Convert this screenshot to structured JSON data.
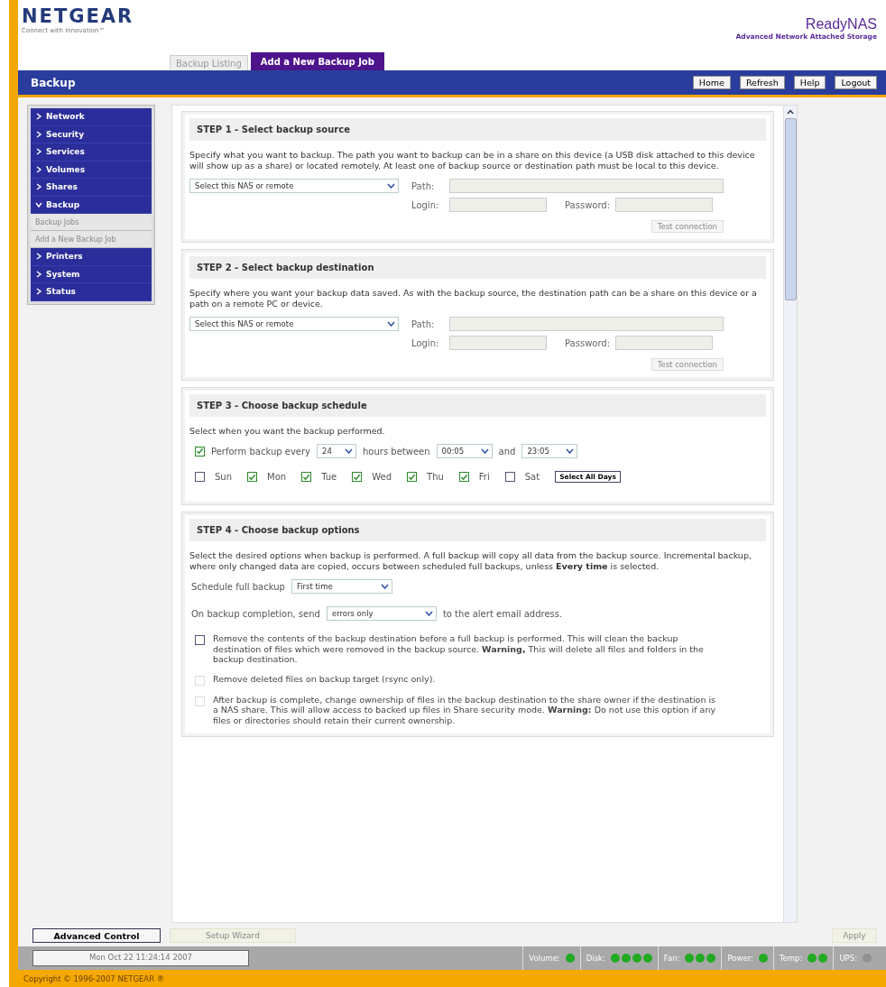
{
  "header": {
    "logo": "NETGEAR",
    "tagline": "Connect with Innovation™",
    "product": "ReadyNAS",
    "product_subtitle": "Advanced Network Attached Storage"
  },
  "tabs": [
    {
      "label": "Backup Listing",
      "selected": false
    },
    {
      "label": "Add a New Backup Job",
      "selected": true
    }
  ],
  "title_bar": {
    "title": "Backup",
    "buttons": [
      "Home",
      "Refresh",
      "Help",
      "Logout"
    ]
  },
  "sidebar": {
    "items": [
      {
        "label": "Network",
        "expanded": false
      },
      {
        "label": "Security",
        "expanded": false
      },
      {
        "label": "Services",
        "expanded": false
      },
      {
        "label": "Volumes",
        "expanded": false
      },
      {
        "label": "Shares",
        "expanded": false
      },
      {
        "label": "Backup",
        "expanded": true,
        "children": [
          {
            "label": "Backup Jobs"
          },
          {
            "label": "Add a New Backup Job"
          }
        ]
      },
      {
        "label": "Printers",
        "expanded": false
      },
      {
        "label": "System",
        "expanded": false
      },
      {
        "label": "Status",
        "expanded": false
      }
    ]
  },
  "step1": {
    "title": "STEP 1 - Select backup source",
    "description": "Specify what you want to backup. The path you want to backup can be in a share on this device (a USB disk attached to this device will show up as a share) or located remotely. At least one of backup source or destination path must be local to this device.",
    "select": "Select this NAS or remote",
    "path_label": "Path:",
    "login_label": "Login:",
    "password_label": "Password:",
    "test_button": "Test connection"
  },
  "step2": {
    "title": "STEP 2 - Select backup destination",
    "description": "Specify where you want your backup data saved. As with the backup source, the destination path can be a share on this device or a path on a remote PC or device.",
    "select": "Select this NAS or remote",
    "path_label": "Path:",
    "login_label": "Login:",
    "password_label": "Password:",
    "test_button": "Test connection"
  },
  "step3": {
    "title": "STEP 3 - Choose backup schedule",
    "description": "Select when you want the backup performed.",
    "perform": {
      "checked": true,
      "label": "Perform backup every",
      "hours": "24",
      "hours_label": "hours between",
      "start": "00:05",
      "and_label": "and",
      "end": "23:05"
    },
    "days": [
      {
        "label": "Sun",
        "checked": false
      },
      {
        "label": "Mon",
        "checked": true
      },
      {
        "label": "Tue",
        "checked": true
      },
      {
        "label": "Wed",
        "checked": true
      },
      {
        "label": "Thu",
        "checked": true
      },
      {
        "label": "Fri",
        "checked": true
      },
      {
        "label": "Sat",
        "checked": false
      }
    ],
    "select_all_button": "Select All Days"
  },
  "step4": {
    "title": "STEP 4 - Choose backup options",
    "description": "Select the desired options when backup is performed. A full backup will copy all data from the backup source. Incremental backup, where only changed data are copied, occurs between scheduled full backups, unless **Every time** is selected.",
    "full_backup_label": "Schedule full backup",
    "full_backup": "First time",
    "send_label": "On backup completion, send",
    "send": "errors only",
    "send_suffix": "to the alert email address.",
    "options": [
      {
        "text": "Remove the contents of the backup destination before a full backup is performed. This will clean the backup destination of files which were removed in the backup source. **Warning,** This will delete all files and folders in the backup destination.",
        "checked": false,
        "disabled": false
      },
      {
        "text": "Remove deleted files on backup target (rsync only).",
        "checked": false,
        "disabled": true
      },
      {
        "text": "After backup is complete, change ownership of files in the backup destination to the share owner if the destination is a NAS share. This will allow access to backed up files in Share security mode. **Warning:** Do not use this option if any files or directories should retain their current ownership.",
        "checked": false,
        "disabled": true
      }
    ]
  },
  "bottom_bar": {
    "advanced_button": "Advanced Control",
    "wizard_button": "Setup Wizard",
    "apply_button": "Apply"
  },
  "status_bar": {
    "datetime": "Mon Oct 22  11:24:14 2007",
    "indicators": [
      {
        "label": "Volume:",
        "lights": [
          {
            "color": "#22aa22"
          }
        ]
      },
      {
        "label": "Disk:",
        "lights": [
          {
            "color": "#22aa22"
          },
          {
            "color": "#22aa22"
          },
          {
            "color": "#22aa22"
          },
          {
            "color": "#22aa22"
          }
        ]
      },
      {
        "label": "Fan:",
        "lights": [
          {
            "color": "#22aa22"
          },
          {
            "color": "#22aa22"
          },
          {
            "color": "#22aa22"
          }
        ]
      },
      {
        "label": "Power:",
        "lights": [
          {
            "color": "#22aa22"
          }
        ]
      },
      {
        "label": "Temp:",
        "lights": [
          {
            "color": "#22aa22"
          },
          {
            "color": "#22aa22"
          }
        ]
      },
      {
        "label": "UPS:",
        "lights": [
          {
            "color": "#909090"
          }
        ]
      }
    ]
  },
  "footer": {
    "copyright": "Copyright © 1996-2007 NETGEAR ®"
  }
}
